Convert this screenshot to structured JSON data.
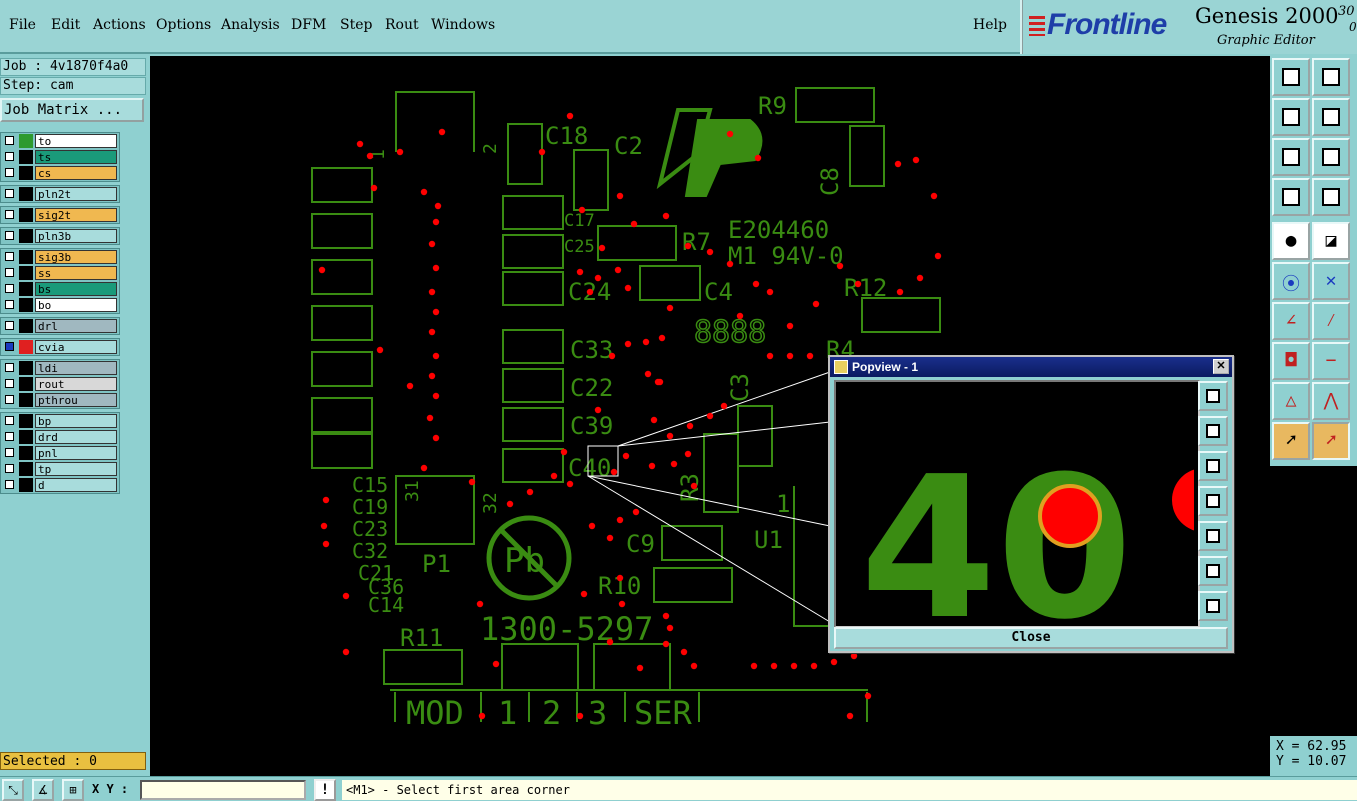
{
  "menu": {
    "items": [
      {
        "key": "file",
        "label": "File"
      },
      {
        "key": "edit",
        "label": "Edit"
      },
      {
        "key": "actions",
        "label": "Actions"
      },
      {
        "key": "options",
        "label": "Options"
      },
      {
        "key": "analysis",
        "label": "Analysis"
      },
      {
        "key": "dfm",
        "label": "DFM"
      },
      {
        "key": "step",
        "label": "Step"
      },
      {
        "key": "rout",
        "label": "Rout"
      },
      {
        "key": "windows",
        "label": "Windows"
      }
    ],
    "help": "Help"
  },
  "brand": {
    "logo_text": "Frontline",
    "product": "Genesis 2000",
    "version": "30",
    "version_sub": "0:",
    "subtitle": "Graphic Editor"
  },
  "left_panel": {
    "job": "Job : 4v1870f4a0",
    "step": "Step: cam",
    "job_matrix": "Job Matrix ...",
    "selected": "Selected : 0"
  },
  "layer_groups": [
    {
      "layers": [
        {
          "name": "to",
          "swatch": "#2e9a2e",
          "bg": "#ffffff"
        },
        {
          "name": "ts",
          "swatch": "#000000",
          "bg": "#1a9a7a"
        },
        {
          "name": "cs",
          "swatch": "#000000",
          "bg": "#f0b850"
        }
      ]
    },
    {
      "layers": [
        {
          "name": "pln2t",
          "swatch": "#000000",
          "bg": "#a8dcdc"
        }
      ]
    },
    {
      "layers": [
        {
          "name": "sig2t",
          "swatch": "#000000",
          "bg": "#f0b850"
        }
      ]
    },
    {
      "layers": [
        {
          "name": "pln3b",
          "swatch": "#000000",
          "bg": "#a8dcdc"
        }
      ]
    },
    {
      "layers": [
        {
          "name": "sig3b",
          "swatch": "#000000",
          "bg": "#f0b850"
        },
        {
          "name": "ss",
          "swatch": "#000000",
          "bg": "#f0b850"
        },
        {
          "name": "bs",
          "swatch": "#000000",
          "bg": "#1a9a7a"
        },
        {
          "name": "bo",
          "swatch": "#000000",
          "bg": "#ffffff"
        }
      ]
    },
    {
      "layers": [
        {
          "name": "drl",
          "swatch": "#000000",
          "bg": "#a0b8c0"
        }
      ]
    },
    {
      "layers": [
        {
          "name": "cvia",
          "swatch": "#e02020",
          "bg": "#a8dcdc",
          "active": true
        }
      ]
    },
    {
      "layers": [
        {
          "name": "ldi",
          "swatch": "#000000",
          "bg": "#a0b8c0"
        },
        {
          "name": "rout",
          "swatch": "#000000",
          "bg": "#d8d8d8"
        },
        {
          "name": "pthrou",
          "swatch": "#000000",
          "bg": "#a0b8c0"
        }
      ]
    },
    {
      "layers": [
        {
          "name": "bp",
          "swatch": "#000000",
          "bg": "#a8dcdc"
        },
        {
          "name": "drd",
          "swatch": "#000000",
          "bg": "#a8dcdc"
        },
        {
          "name": "pnl",
          "swatch": "#000000",
          "bg": "#a8dcdc"
        },
        {
          "name": "tp",
          "swatch": "#000000",
          "bg": "#a8dcdc"
        },
        {
          "name": "d",
          "swatch": "#000000",
          "bg": "#a8dcdc"
        }
      ]
    }
  ],
  "canvas_labels": {
    "c18": "C18",
    "c2": "C2",
    "r9": "R9",
    "c8": "C8",
    "c17": "C17",
    "c25": "C25",
    "r7": "R7",
    "e_code": "E204460",
    "m1": "M1 94V-0",
    "c24": "C24",
    "c4": "C4",
    "r12": "R12",
    "date_code": "8888",
    "c33": "C33",
    "c22": "C22",
    "c39": "C39",
    "c40": "C40",
    "c3": "C3",
    "r3": "R3",
    "r4": "R4",
    "c15": "C15",
    "c19": "C19",
    "c23": "C23",
    "c32": "C32",
    "c21": "C21",
    "c36": "C36",
    "c14": "C14",
    "p1": "P1",
    "pin1": "1",
    "pin2": "2",
    "pin31": "31",
    "pin32": "32",
    "pb": "Pb",
    "c9": "C9",
    "r10": "R10",
    "u1": "U1",
    "u1pin": "1",
    "r11": "R11",
    "part_no": "1300-5297",
    "mod": "MOD",
    "j1": "1",
    "j2": "2",
    "j3": "3",
    "ser": "SER"
  },
  "popview": {
    "title": "Popview - 1",
    "zoom_text": "40",
    "close_label": "Close",
    "close_x": "✕"
  },
  "coords": {
    "x": "X = 62.95",
    "y": "Y = 10.07"
  },
  "bottom": {
    "xy_label": "X Y :",
    "xy_value": "",
    "prompt_icon": "!",
    "prompt": "<M1> - Select first area corner"
  },
  "colors": {
    "copper": "#3a8c12",
    "pad": "#ff0000",
    "background": "#000000",
    "panel": "#8fd0d0"
  }
}
